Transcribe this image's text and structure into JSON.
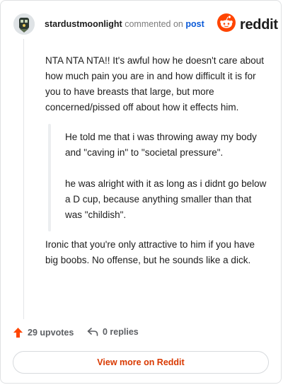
{
  "header": {
    "username": "stardustmoonlight",
    "action_text": "commented on",
    "post_link": "post",
    "brand": "reddit"
  },
  "comment": {
    "paragraph_1": "NTA NTA NTA!! It's awful how he doesn't care about how much pain you are in and how difficult it is for you to have breasts that large, but more concerned/pissed off about how it effects him.",
    "quote_1": "He told me that i was throwing away my body and \"caving in\" to \"societal pressure\".",
    "quote_2": "he was alright with it as long as i didnt go below a D cup, because anything smaller than that was \"childish\".",
    "paragraph_2": "Ironic that you're only attractive to him if you have big boobs. No offense, but he sounds like a dick."
  },
  "actions": {
    "upvotes": "29 upvotes",
    "replies": "0 replies"
  },
  "footer": {
    "view_more": "View more on Reddit"
  },
  "colors": {
    "brand_orange": "#ff4500",
    "link_blue": "#0a5ad8",
    "button_text": "#d93900"
  },
  "icons": {
    "avatar": "user-avatar",
    "brand": "reddit-logo-icon",
    "upvote": "upvote-arrow-icon",
    "reply": "reply-arrow-icon"
  }
}
